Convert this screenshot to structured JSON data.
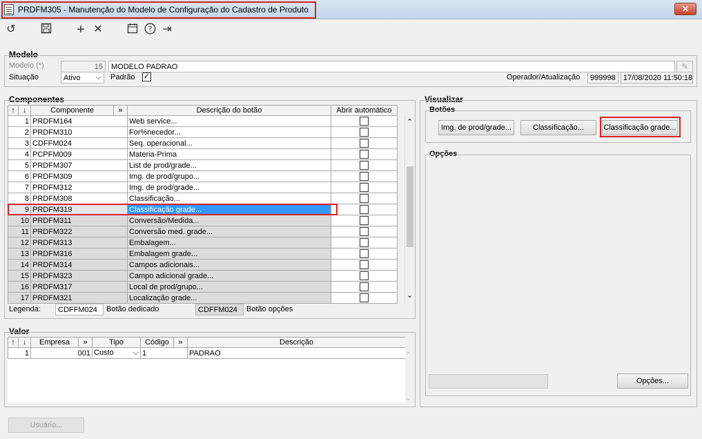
{
  "window": {
    "title": "PRDFM305 - Manutenção do Modelo de Configuração do Cadastro de Produto",
    "close": "✕"
  },
  "toolbar": {
    "icons": [
      "refresh-icon",
      "save-icon",
      "add-icon",
      "delete-icon",
      "calendar-icon",
      "help-icon",
      "exit-icon"
    ],
    "glyphs": {
      "refresh": "↺",
      "save": "🖫",
      "add": "+",
      "delete": "✕",
      "calendar": "📅",
      "help": "?",
      "exit": "⇥"
    }
  },
  "modelo": {
    "group_label": "Modelo",
    "modelo_label": "Modelo (*)",
    "modelo_number": "15",
    "modelo_name": "MODELO PADRAO",
    "situacao_label": "Situação",
    "situacao_value": "Ativo",
    "padrao_label": "Padrão",
    "operador_label": "Operador/Atualização",
    "operador_value": "999998",
    "data_value": "17/08/2020 11:50:18"
  },
  "componentes": {
    "group_label": "Componentes",
    "headers": {
      "up": "↑",
      "down": "↓",
      "componente": "Componente",
      "more": "»",
      "descricao": "Descrição do botão",
      "abrir": "Abrir automático"
    },
    "rows": [
      {
        "n": "1",
        "comp": "PRDFM164",
        "desc": "Web service..."
      },
      {
        "n": "2",
        "comp": "PRDFM310",
        "desc": "For%necedor..."
      },
      {
        "n": "3",
        "comp": "CDFFM024",
        "desc": "Seq. operacional..."
      },
      {
        "n": "4",
        "comp": "PCPFM009",
        "desc": "Materia-Prima"
      },
      {
        "n": "5",
        "comp": "PRDFM307",
        "desc": "List de prod/grade..."
      },
      {
        "n": "6",
        "comp": "PRDFM309",
        "desc": "Img. de prod/grupo..."
      },
      {
        "n": "7",
        "comp": "PRDFM312",
        "desc": "Img. de prod/grade..."
      },
      {
        "n": "8",
        "comp": "PRDFM308",
        "desc": "Classificação..."
      },
      {
        "n": "9",
        "comp": "PRDFM319",
        "desc": "Classificação grade..."
      },
      {
        "n": "10",
        "comp": "PRDFM311",
        "desc": "Conversão/Medida..."
      },
      {
        "n": "11",
        "comp": "PRDFM322",
        "desc": "Conversão med. grade..."
      },
      {
        "n": "12",
        "comp": "PRDFM313",
        "desc": "Embalagem..."
      },
      {
        "n": "13",
        "comp": "PRDFM316",
        "desc": "Embalagem grade..."
      },
      {
        "n": "14",
        "comp": "PRDFM314",
        "desc": "Campos adicionais..."
      },
      {
        "n": "15",
        "comp": "PRDFM323",
        "desc": "Campo adicional grade..."
      },
      {
        "n": "16",
        "comp": "PRDFM317",
        "desc": "Local de prod/grupo..."
      },
      {
        "n": "17",
        "comp": "PRDFM321",
        "desc": "Localização grade..."
      }
    ],
    "legenda_label": "Legenda:",
    "legenda_1_value": "CDFFM024",
    "legenda_1_text": "Botão dedicado",
    "legenda_2_value": "CDFFM024",
    "legenda_2_text": "Botão opções",
    "scroll_up": "⌃",
    "scroll_down": "⌄"
  },
  "valor": {
    "group_label": "Valor",
    "headers": {
      "up": "↑",
      "down": "↓",
      "empresa": "Empresa",
      "more1": "»",
      "tipo": "Tipo",
      "codigo": "Código",
      "more2": "»",
      "descricao": "Descrição"
    },
    "row": {
      "n": "1",
      "empresa": "001",
      "tipo": "Custo",
      "codigo": "1",
      "descricao": "PADRAO"
    }
  },
  "usuario_button": "Usuário...",
  "visualizar": {
    "group_label": "Visualizar",
    "botoes_label": "Botões",
    "buttons": [
      "Img. de prod/grade...",
      "Classificação...",
      "Classificação grade..."
    ],
    "opcoes_label": "Opções",
    "opcoes_button": "Opções..."
  }
}
